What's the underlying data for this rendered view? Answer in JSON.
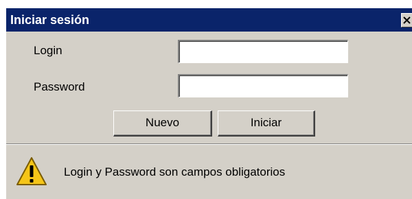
{
  "window": {
    "title": "Iniciar sesión",
    "close_glyph": "✕",
    "close_icon": "close-icon"
  },
  "form": {
    "login_label": "Login",
    "login_value": "",
    "password_label": "Password",
    "password_value": ""
  },
  "buttons": {
    "new_label": "Nuevo",
    "start_label": "Iniciar"
  },
  "status": {
    "icon": "warning-icon",
    "message": "Login y Password son campos obligatorios"
  },
  "colors": {
    "titlebar": "#0a246a",
    "dialog_bg": "#d4d0c8",
    "warning_fill": "#f5c518"
  }
}
